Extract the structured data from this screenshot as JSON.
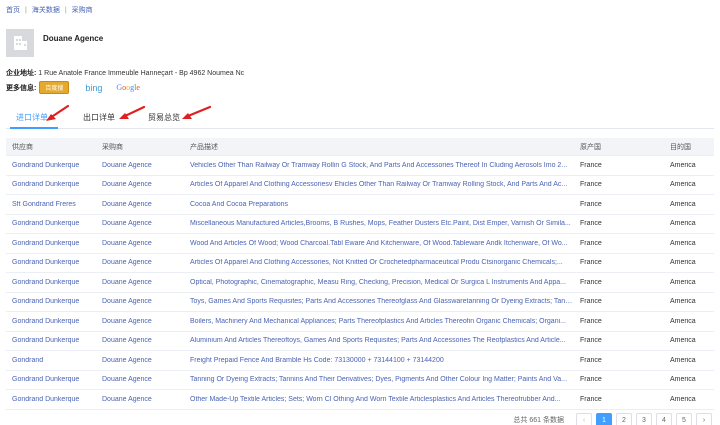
{
  "breadcrumb": [
    "首页",
    "海关数据",
    "采购商"
  ],
  "company": {
    "name": "Douane Agence"
  },
  "address": {
    "label": "企业地址:",
    "value": "1 Rue Anatole France Immeuble Hanneçart - Bp 4962 Noumea Nc"
  },
  "more_info": {
    "label": "更多信息:",
    "baidu": "百度搜",
    "bing": "bing",
    "google": [
      "G",
      "o",
      "o",
      "g",
      "l",
      "e"
    ]
  },
  "tabs": [
    {
      "label": "进口详单",
      "active": true
    },
    {
      "label": "出口详单",
      "active": false
    },
    {
      "label": "贸易总览",
      "active": false
    }
  ],
  "table": {
    "headers": [
      "供应商",
      "采购商",
      "产品描述",
      "原产国",
      "目的国"
    ],
    "rows": [
      [
        "Gondrand Dunkerque",
        "Douane Agence",
        "Vehicles Other Than Railway Or Tramway Rollin G Stock, And Parts And Accessories Thereof In Cluding Aerosols Imo 2...",
        "France",
        "America"
      ],
      [
        "Gondrand Dunkerque",
        "Douane Agence",
        "Articles Of Apparel And Clothing Accessoriesv Ehicles Other Than Railway Or Tramway Rolling Stock, And Parts And Ac...",
        "France",
        "America"
      ],
      [
        "Sft Gondrand Freres",
        "Douane Agence",
        "Cocoa And Cocoa Preparations",
        "France",
        "America"
      ],
      [
        "Gondrand Dunkerque",
        "Douane Agence",
        "Miscellaneous Manufactured Articles,Brooms, B Rushes, Mops, Feather Dusters Etc.Paint, Dist Emper, Varnish Or Simila...",
        "France",
        "America"
      ],
      [
        "Gondrand Dunkerque",
        "Douane Agence",
        "Wood And Articles Of Wood; Wood Charcoal.Tabl Eware And Kitchenware, Of Wood.Tableware Andk Itchenware, Of Wo...",
        "France",
        "America"
      ],
      [
        "Gondrand Dunkerque",
        "Douane Agence",
        "Articles Of Apparel And Clothing Accessories, Not Knitted Or Crochetedpharmaceutical Produ Ctsinorganic Chemicals;...",
        "France",
        "America"
      ],
      [
        "Gondrand Dunkerque",
        "Douane Agence",
        "Optical, Photographic, Cinematographic, Measu Ring, Checking, Precision, Medical Or Surgica L Instruments And Appa...",
        "France",
        "America"
      ],
      [
        "Gondrand Dunkerque",
        "Douane Agence",
        "Toys, Games And Sports Requisites; Parts And Accessories Thereofglass And Glasswaretanning Or Dyeing Extracts; Tann...",
        "France",
        "America"
      ],
      [
        "Gondrand Dunkerque",
        "Douane Agence",
        "Boilers, Machinery And Mechanical Appliances; Parts Thereofplastics And Articles Thereofin Organic Chemicals; Organi...",
        "France",
        "America"
      ],
      [
        "Gondrand Dunkerque",
        "Douane Agence",
        "Aluminium And Articles Thereoftoys, Games And Sports Requisites; Parts And Accessories The Reofplastics And Article...",
        "France",
        "America"
      ],
      [
        "Gondrand",
        "Douane Agence",
        "Freight Prepaid Fence And Bramble Hs Code: 73130000 + 73144100 + 73144200",
        "France",
        "America"
      ],
      [
        "Gondrand Dunkerque",
        "Douane Agence",
        "Tanning Or Dyeing Extracts; Tannins And Their Derivatives; Dyes, Pigments And Other Colour Ing Matter; Paints And Va...",
        "France",
        "America"
      ],
      [
        "Gondrand Dunkerque",
        "Douane Agence",
        "Other Made-Up Textile Articles; Sets; Worn Cl Othing And Worn Textile Articlesplastics And Articles Thereofrubber And...",
        "France",
        "America"
      ]
    ]
  },
  "pagination": {
    "total": "总共 661 条数据",
    "prev": "‹",
    "pages": [
      "1",
      "2",
      "3",
      "4",
      "5"
    ],
    "next": "›",
    "current": "1"
  },
  "colors": {
    "accent": "#409eff",
    "link": "#4a63b5",
    "arrow": "#e02020"
  }
}
